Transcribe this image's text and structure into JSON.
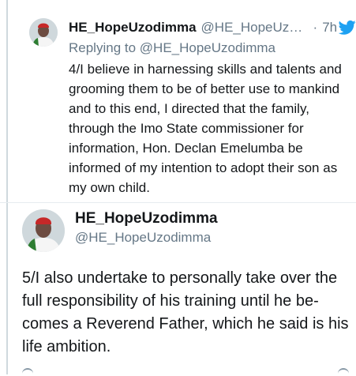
{
  "reply_tweet": {
    "author_name": "HE_HopeUzodimma",
    "author_handle": "@HE_HopeUzodimma",
    "time": "7h",
    "replying_prefix": "Replying to ",
    "replying_to": "@HE_HopeUzodimma",
    "text": "4/I believe in harnessing skills and talents and grooming them to be of better use to mankind and to this end, I directed that the family, through the Imo State commissioner for information, Hon. Declan Emelumba be informed of my intention to adopt their son as my own child."
  },
  "main_tweet": {
    "author_name": "HE_HopeUzodimma",
    "author_handle": "@HE_HopeUzodimma",
    "text": "5/I also undertake to personally take over the full responsibility of his training until he be-comes a Reverend Father, which he said is his life ambition."
  },
  "icons": {
    "brand": "twitter-bird-icon",
    "brand_color": "#1da1f2"
  },
  "colors": {
    "text": "#14171a",
    "secondary": "#657786",
    "thread_line": "#cfd9de"
  }
}
